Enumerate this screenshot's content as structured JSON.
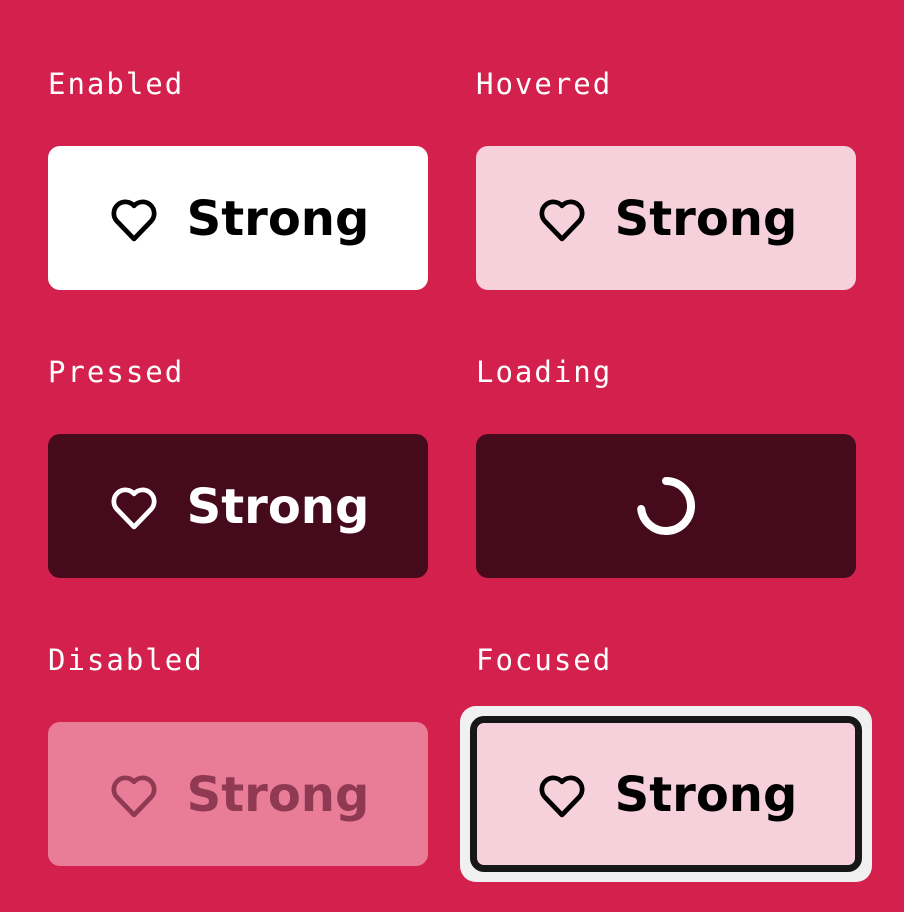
{
  "colors": {
    "page_background": "#D4204C",
    "enabled_bg": "#FFFFFF",
    "hovered_bg": "#F6D1DB",
    "pressed_bg": "#450A1B",
    "disabled_bg": "#E97D97",
    "disabled_text": "#8F3A52",
    "focus_border": "#171717",
    "focus_ring": "#F0F0F0"
  },
  "states": {
    "enabled": {
      "title": "Enabled",
      "button_label": "Strong",
      "icon": "heart-icon"
    },
    "hovered": {
      "title": "Hovered",
      "button_label": "Strong",
      "icon": "heart-icon"
    },
    "pressed": {
      "title": "Pressed",
      "button_label": "Strong",
      "icon": "heart-icon"
    },
    "loading": {
      "title": "Loading",
      "icon": "loading-spinner-icon"
    },
    "disabled": {
      "title": "Disabled",
      "button_label": "Strong",
      "icon": "heart-icon"
    },
    "focused": {
      "title": "Focused",
      "button_label": "Strong",
      "icon": "heart-icon"
    }
  }
}
